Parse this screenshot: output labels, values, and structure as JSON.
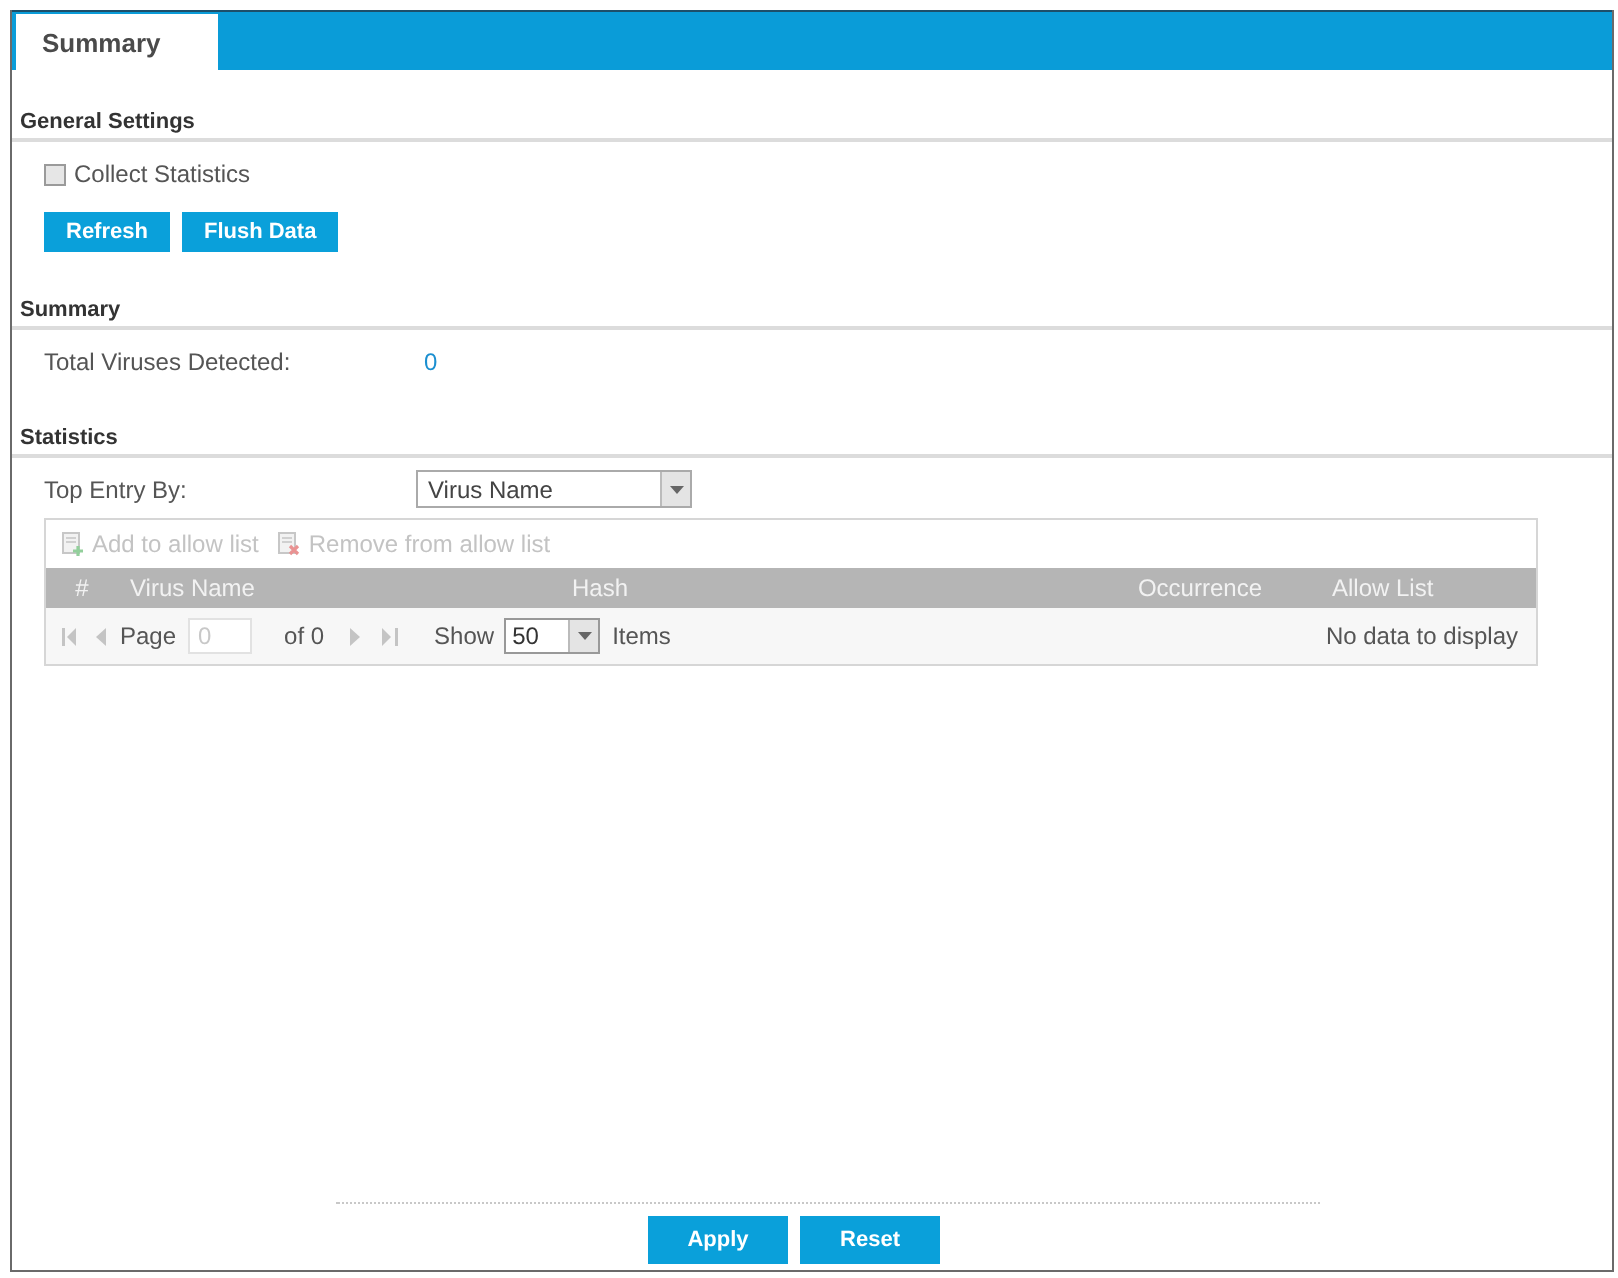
{
  "tabs": [
    {
      "label": "Summary",
      "selected": true
    }
  ],
  "general_settings": {
    "title": "General Settings",
    "collect_statistics": {
      "label": "Collect Statistics",
      "checked": false
    },
    "buttons": [
      "Refresh",
      "Flush Data"
    ]
  },
  "summary": {
    "title": "Summary",
    "fields": [
      {
        "label": "Total Viruses Detected:",
        "value": "0"
      }
    ]
  },
  "statistics": {
    "title": "Statistics",
    "top_entry_by": {
      "label": "Top Entry By:",
      "value": "Virus Name"
    },
    "toolbar": [
      {
        "kind": "add",
        "label": "Add to allow list",
        "disabled": true
      },
      {
        "kind": "remove",
        "label": "Remove from allow list",
        "disabled": true
      }
    ],
    "table": {
      "columns": [
        "#",
        "Virus Name",
        "Hash",
        "Occurrence",
        "Allow List"
      ]
    },
    "pager": {
      "page_label": "Page",
      "page_value": "0",
      "of_label": "of 0",
      "show_label": "Show",
      "page_size": "50",
      "items_label": "Items",
      "status": "No data to display"
    }
  },
  "buttons": [
    "Apply",
    "Reset"
  ]
}
